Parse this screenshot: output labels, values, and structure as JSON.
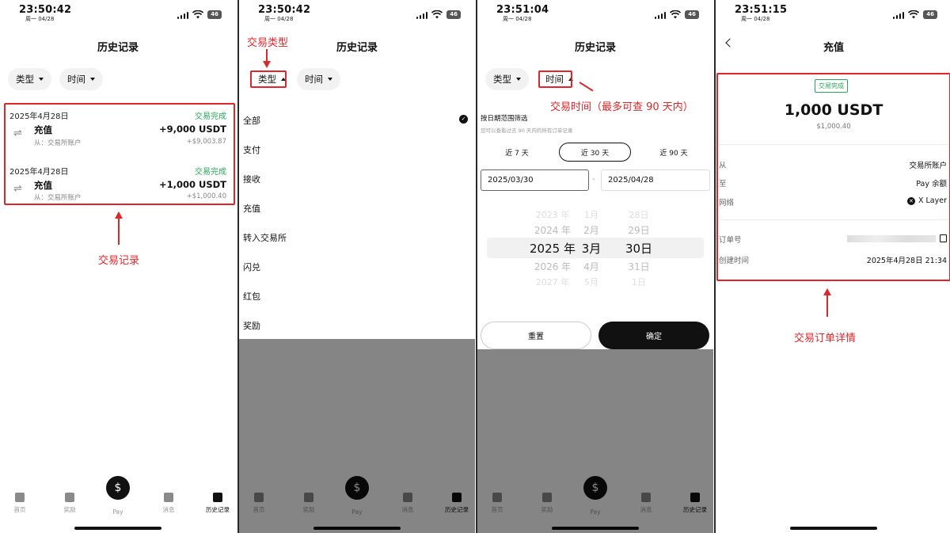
{
  "colors": {
    "accent_red": "#e0262b",
    "success_green": "#2ca65a",
    "primary_black": "#111111"
  },
  "tabbar": {
    "items": [
      "首页",
      "奖励",
      "Pay",
      "消息",
      "历史记录"
    ]
  },
  "screen1": {
    "time": "23:50:42",
    "date": "周一 04/28",
    "battery": "46",
    "title": "历史记录",
    "filters": {
      "type": "类型",
      "time": "时间"
    },
    "records": [
      {
        "date": "2025年4月28日",
        "status": "交易完成",
        "type": "充值",
        "amount": "+9,000 USDT",
        "from": "从：交易所账户",
        "fiat": "+$9,003.87"
      },
      {
        "date": "2025年4月28日",
        "status": "交易完成",
        "type": "充值",
        "amount": "+1,000 USDT",
        "from": "从：交易所账户",
        "fiat": "+$1,000.40"
      }
    ],
    "annotation": "交易记录"
  },
  "screen2": {
    "time": "23:50:42",
    "date": "周一 04/28",
    "battery": "46",
    "title": "历史记录",
    "filters": {
      "type": "类型",
      "time": "时间"
    },
    "annotation": "交易类型",
    "menu": [
      "全部",
      "支付",
      "接收",
      "充值",
      "转入交易所",
      "闪兑",
      "红包",
      "奖励"
    ]
  },
  "screen3": {
    "time": "23:51:04",
    "date": "周一 04/28",
    "battery": "46",
    "title": "历史记录",
    "filters": {
      "type": "类型",
      "time": "时间"
    },
    "annotation": "交易时间（最多可查 90 天内）",
    "section_title": "按日期范围筛选",
    "hint": "您可以查看过去 90 天内的所有订单记录",
    "ranges": [
      "近 7 天",
      "近 30 天",
      "近 90 天"
    ],
    "start_date": "2025/03/30",
    "date_sep": "-",
    "end_date": "2025/04/28",
    "years": [
      "2023 年",
      "2024 年",
      "2025 年",
      "2026 年",
      "2027 年"
    ],
    "months": [
      "1月",
      "2月",
      "3月",
      "4月",
      "5月"
    ],
    "days": [
      "28日",
      "29日",
      "30日",
      "31日",
      "1日"
    ],
    "reset": "重置",
    "confirm": "确定"
  },
  "screen4": {
    "time": "23:51:15",
    "date": "周一 04/28",
    "battery": "46",
    "title": "充值",
    "status": "交易完成",
    "amount": "1,000 USDT",
    "fiat": "$1,000.40",
    "rows": [
      {
        "label": "从",
        "value": "交易所账户"
      },
      {
        "label": "至",
        "value": "Pay 余额"
      },
      {
        "label": "网络",
        "value": "X Layer"
      },
      {
        "label": "订单号",
        "value": ""
      },
      {
        "label": "创建时间",
        "value": "2025年4月28日 21:34"
      }
    ],
    "annotation": "交易订单详情"
  }
}
